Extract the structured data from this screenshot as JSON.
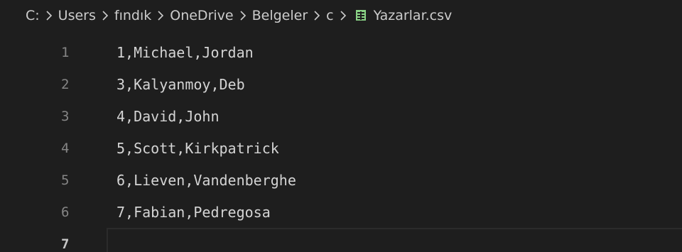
{
  "breadcrumb": {
    "segments": [
      "C:",
      "Users",
      "fındık",
      "OneDrive",
      "Belgeler",
      "c"
    ],
    "file_name": "Yazarlar.csv",
    "file_icon": "csv-table-icon"
  },
  "editor": {
    "lines": [
      {
        "number": "1",
        "text": "1,Michael,Jordan"
      },
      {
        "number": "2",
        "text": "3,Kalyanmoy,Deb"
      },
      {
        "number": "3",
        "text": "4,David,John"
      },
      {
        "number": "4",
        "text": "5,Scott,Kirkpatrick"
      },
      {
        "number": "5",
        "text": "6,Lieven,Vandenberghe"
      },
      {
        "number": "6",
        "text": "7,Fabian,Pedregosa"
      },
      {
        "number": "7",
        "text": ""
      }
    ],
    "current_line": "7"
  },
  "colors": {
    "background": "#1e1e1e",
    "text": "#d4d4d4",
    "line_number": "#858585",
    "breadcrumb": "#cccccc",
    "csv_icon": "#89d185"
  }
}
